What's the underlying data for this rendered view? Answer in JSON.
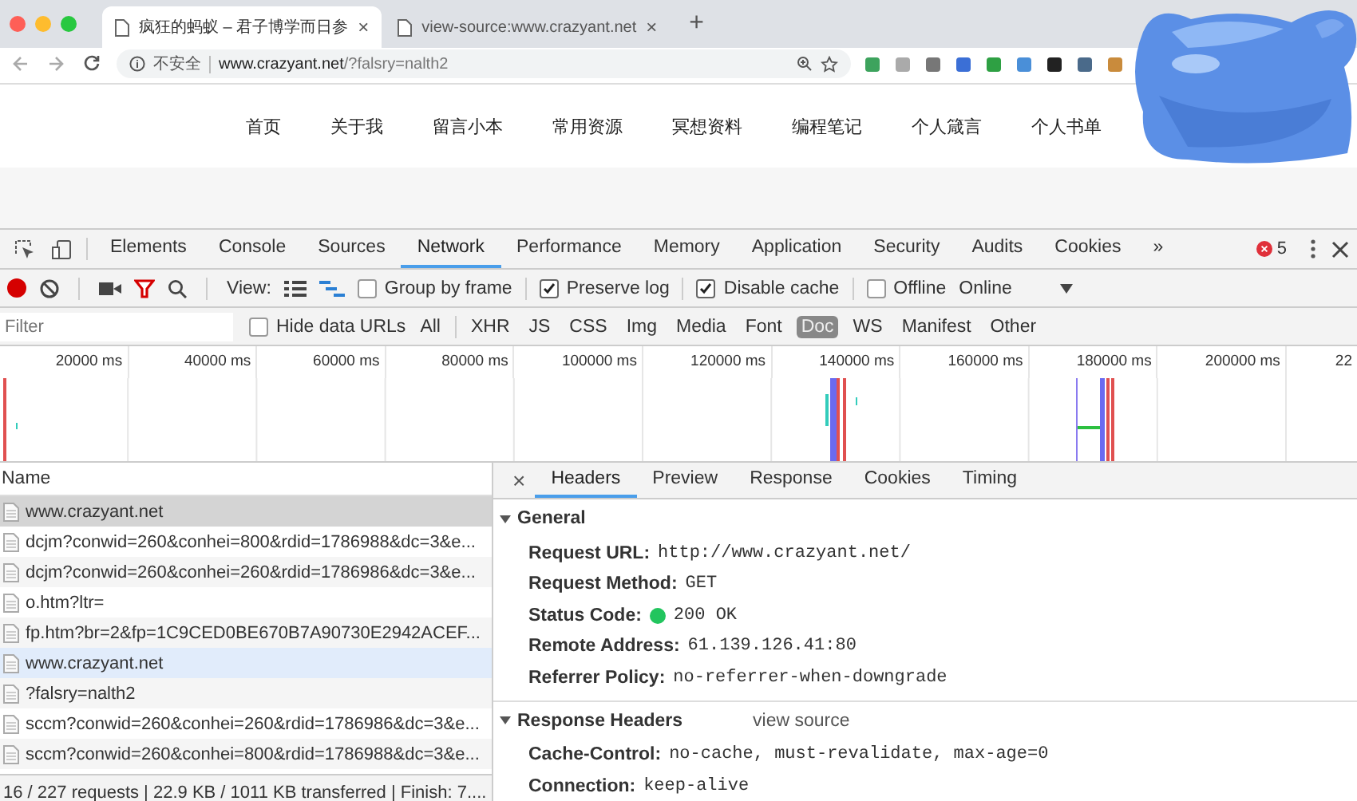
{
  "browser": {
    "tabs": [
      {
        "title": "疯狂的蚂蚁 – 君子博学而日参",
        "selected": true
      },
      {
        "title": "view-source:www.crazyant.net",
        "selected": false
      }
    ],
    "tab_close": "×",
    "new_tab": "+",
    "address": {
      "security": "不安全",
      "host": "www.crazyant.net",
      "path": "/?falsry=nalth2"
    }
  },
  "page": {
    "nav": [
      "首页",
      "关于我",
      "留言小本",
      "常用资源",
      "冥想资料",
      "编程笔记",
      "个人箴言",
      "个人书单"
    ]
  },
  "devtools": {
    "panel_tabs": [
      {
        "label": "Elements",
        "selected": false
      },
      {
        "label": "Console",
        "selected": false
      },
      {
        "label": "Sources",
        "selected": false
      },
      {
        "label": "Network",
        "selected": true
      },
      {
        "label": "Performance",
        "selected": false
      },
      {
        "label": "Memory",
        "selected": false
      },
      {
        "label": "Application",
        "selected": false
      },
      {
        "label": "Security",
        "selected": false
      },
      {
        "label": "Audits",
        "selected": false
      },
      {
        "label": "Cookies",
        "selected": false
      }
    ],
    "more": "»",
    "error_count": "5",
    "toolbar": {
      "recording": true,
      "view_label": "View:",
      "checkboxes": [
        {
          "label": "Group by frame",
          "checked": false
        },
        {
          "label": "Preserve log",
          "checked": true
        },
        {
          "label": "Disable cache",
          "checked": true
        },
        {
          "label": "Offline",
          "checked": false
        }
      ],
      "throttle": "Online"
    },
    "filter": {
      "placeholder": "Filter",
      "hide_data_urls": {
        "label": "Hide data URLs",
        "checked": false
      },
      "types": [
        {
          "label": "All",
          "selected": false
        },
        {
          "label": "XHR",
          "selected": false
        },
        {
          "label": "JS",
          "selected": false
        },
        {
          "label": "CSS",
          "selected": false
        },
        {
          "label": "Img",
          "selected": false
        },
        {
          "label": "Media",
          "selected": false
        },
        {
          "label": "Font",
          "selected": false
        },
        {
          "label": "Doc",
          "selected": true
        },
        {
          "label": "WS",
          "selected": false
        },
        {
          "label": "Manifest",
          "selected": false
        },
        {
          "label": "Other",
          "selected": false
        }
      ]
    },
    "timeline_ticks": [
      "20000 ms",
      "40000 ms",
      "60000 ms",
      "80000 ms",
      "100000 ms",
      "120000 ms",
      "140000 ms",
      "160000 ms",
      "180000 ms",
      "200000 ms",
      "22"
    ],
    "requests": {
      "header": "Name",
      "rows": [
        {
          "name": "www.crazyant.net",
          "selected": true,
          "hovered": false
        },
        {
          "name": "dcjm?conwid=260&conhei=800&rdid=1786988&dc=3&e...",
          "selected": false,
          "hovered": false
        },
        {
          "name": "dcjm?conwid=260&conhei=260&rdid=1786986&dc=3&e...",
          "selected": false,
          "hovered": false
        },
        {
          "name": "o.htm?ltr=",
          "selected": false,
          "hovered": false
        },
        {
          "name": "fp.htm?br=2&fp=1C9CED0BE670B7A90730E2942ACEF...",
          "selected": false,
          "hovered": false
        },
        {
          "name": "www.crazyant.net",
          "selected": false,
          "hovered": true
        },
        {
          "name": "?falsry=nalth2",
          "selected": false,
          "hovered": false
        },
        {
          "name": "sccm?conwid=260&conhei=260&rdid=1786986&dc=3&e...",
          "selected": false,
          "hovered": false
        },
        {
          "name": "sccm?conwid=260&conhei=800&rdid=1786988&dc=3&e...",
          "selected": false,
          "hovered": false
        }
      ],
      "status": "16 / 227 requests | 22.9 KB / 1011 KB transferred | Finish: 7...."
    },
    "details": {
      "close": "×",
      "tabs": [
        {
          "label": "Headers",
          "selected": true
        },
        {
          "label": "Preview",
          "selected": false
        },
        {
          "label": "Response",
          "selected": false
        },
        {
          "label": "Cookies",
          "selected": false
        },
        {
          "label": "Timing",
          "selected": false
        }
      ],
      "sections": [
        {
          "title": "General",
          "expanded": true,
          "rows": [
            {
              "key": "Request URL:",
              "value": "http://www.crazyant.net/"
            },
            {
              "key": "Request Method:",
              "value": "GET"
            },
            {
              "key": "Status Code:",
              "value": "200 OK",
              "color": "#22c55e"
            },
            {
              "key": "Remote Address:",
              "value": "61.139.126.41:80"
            },
            {
              "key": "Referrer Policy:",
              "value": "no-referrer-when-downgrade"
            }
          ]
        },
        {
          "title": "Response Headers",
          "expanded": true,
          "link": "view source",
          "rows": [
            {
              "key": "Cache-Control:",
              "value": "no-cache, must-revalidate, max-age=0"
            },
            {
              "key": "Connection:",
              "value": "keep-alive"
            }
          ]
        }
      ]
    }
  }
}
